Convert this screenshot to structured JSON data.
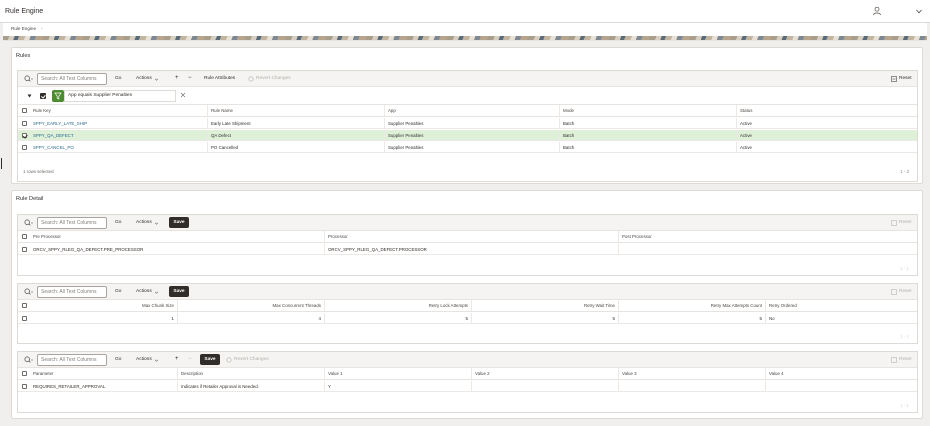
{
  "app": {
    "title": "Rule Engine"
  },
  "breadcrumb": {
    "current": "Rule Engine",
    "separator": "›"
  },
  "common": {
    "search_placeholder": "Search: All Text Columns",
    "go": "Go",
    "actions": "Actions",
    "plus": "+",
    "minus": "−",
    "save": "Save",
    "revert": "Revert Changes",
    "reset": "Reset"
  },
  "rules": {
    "title": "Rules",
    "rule_attributes": "Rule Attributes",
    "filter": "App equals Supplier Penalties",
    "columns": [
      "Rule Key",
      "Rule Name",
      "App",
      "Mode",
      "Status"
    ],
    "rows": [
      [
        "SPPY_EARLY_LATE_SHIP",
        "Early Late Shipment",
        "Supplier Penalties",
        "Batch",
        "Active"
      ],
      [
        "SPPY_QA_DEFECT",
        "QA Defect",
        "Supplier Penalties",
        "Batch",
        "Active"
      ],
      [
        "SPPY_CANCEL_PO",
        "PO Cancelled",
        "Supplier Penalties",
        "Batch",
        "Active"
      ]
    ],
    "selected_row": 1,
    "footer": "1 rows selected",
    "pager": "1 - 3"
  },
  "detail": {
    "title": "Rule Detail",
    "processors": {
      "columns": [
        "Pre Processor",
        "Processor",
        "Post Processor"
      ],
      "row": [
        "ORCV_SPPY_RLEG_QA_DEFECT.PRE_PROCESSOR",
        "ORCV_SPPY_RLEG_QA_DEFECT.PROCESSOR",
        ""
      ],
      "pager": "1 - 1"
    },
    "settings": {
      "columns": [
        "Max Chunk Size",
        "Max Concurrent Threads",
        "Retry Lock Attempts",
        "Retry Wait Time",
        "Retry Max Attempts Count",
        "Retry Ordered"
      ],
      "row": [
        "1",
        "4",
        "5",
        "5",
        "5",
        "No"
      ],
      "pager": "1 - 1"
    },
    "parameters": {
      "columns": [
        "Parameter",
        "Description",
        "Value 1",
        "Value 2",
        "Value 3",
        "Value 4"
      ],
      "row": [
        "REQUIRES_RETAILER_APPROVAL",
        "Indicates if Retailer Approval is Needed.",
        "Y",
        "",
        "",
        ""
      ],
      "pager": "1 - 1"
    }
  }
}
